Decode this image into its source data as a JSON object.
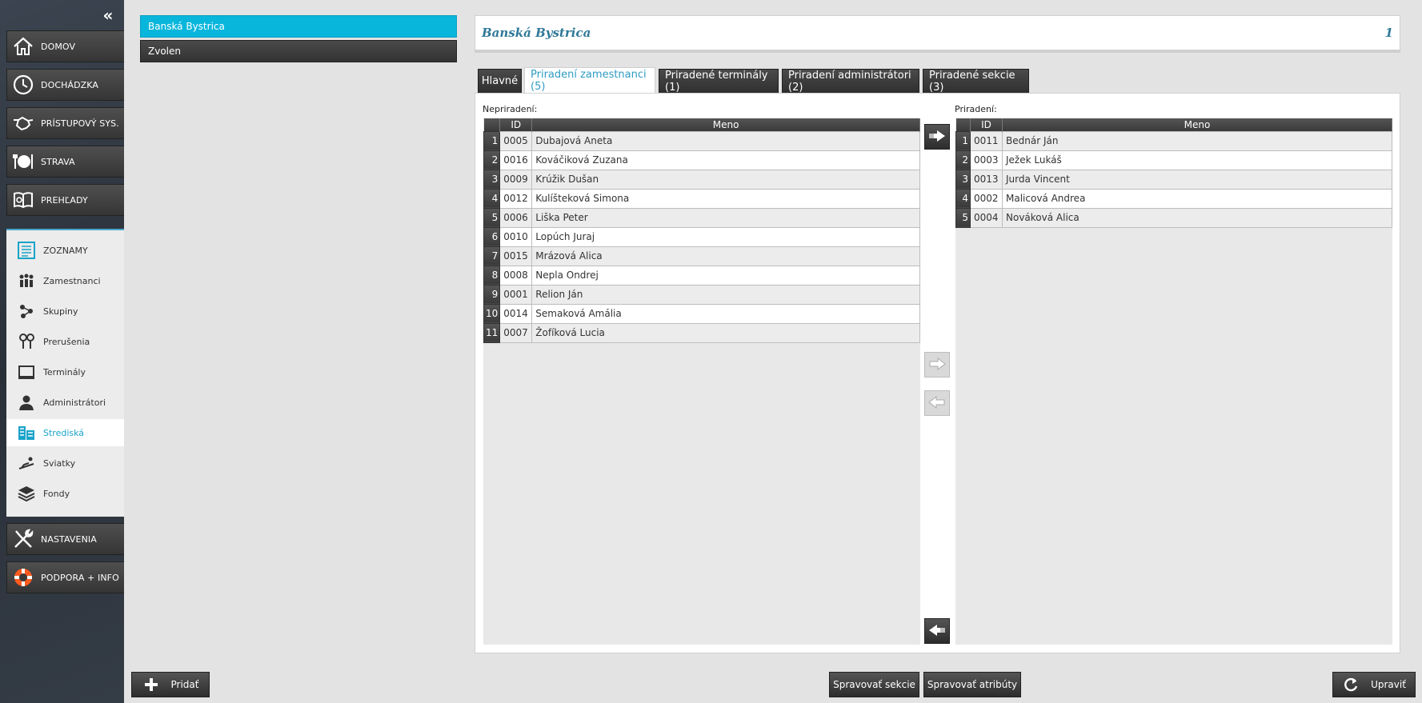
{
  "sidebar": {
    "collapse_icon": "chevron-double-left-icon",
    "main_items": [
      {
        "label": "DOMOV",
        "icon": "home-icon"
      },
      {
        "label": "DOCHÁDZKA",
        "icon": "clock-icon"
      },
      {
        "label": "PRÍSTUPOVÝ SYS.",
        "icon": "handshake-icon"
      },
      {
        "label": "STRAVA",
        "icon": "plate-icon"
      },
      {
        "label": "PREHĽADY",
        "icon": "report-icon"
      }
    ],
    "submenu": {
      "header": {
        "label": "ZOZNAMY",
        "icon": "list-icon"
      },
      "items": [
        {
          "label": "Zamestnanci",
          "icon": "people-icon"
        },
        {
          "label": "Skupiny",
          "icon": "groups-icon"
        },
        {
          "label": "Prerušenia",
          "icon": "pins-icon"
        },
        {
          "label": "Terminály",
          "icon": "terminal-icon"
        },
        {
          "label": "Administrátori",
          "icon": "admin-icon"
        },
        {
          "label": "Strediská",
          "icon": "building-icon",
          "active": true
        },
        {
          "label": "Sviatky",
          "icon": "sunbed-icon"
        },
        {
          "label": "Fondy",
          "icon": "layers-icon"
        }
      ]
    },
    "bottom_items": [
      {
        "label": "NASTAVENIA",
        "icon": "tools-icon"
      },
      {
        "label": "PODPORA + INFO",
        "icon": "lifebuoy-icon"
      }
    ]
  },
  "locations": [
    {
      "label": "Banská Bystrica",
      "selected": true
    },
    {
      "label": "Zvolen",
      "selected": false
    }
  ],
  "detail": {
    "title": "Banská Bystrica",
    "number": "1",
    "tabs": [
      {
        "label": "Hlavné"
      },
      {
        "label": "Priradení zamestnanci (5)",
        "active": true
      },
      {
        "label": "Priradené terminály (1)"
      },
      {
        "label": "Priradení administrátori (2)"
      },
      {
        "label": "Priradené sekcie (3)"
      }
    ],
    "unassigned": {
      "label": "Nepriradení:",
      "columns": [
        "ID",
        "Meno"
      ],
      "rows": [
        {
          "n": "1",
          "id": "0005",
          "name": "Dubajová Aneta"
        },
        {
          "n": "2",
          "id": "0016",
          "name": "Kováčiková Zuzana"
        },
        {
          "n": "3",
          "id": "0009",
          "name": "Krúžik Dušan"
        },
        {
          "n": "4",
          "id": "0012",
          "name": "Kulíšteková Simona"
        },
        {
          "n": "5",
          "id": "0006",
          "name": "Liška Peter"
        },
        {
          "n": "6",
          "id": "0010",
          "name": "Lopúch Juraj"
        },
        {
          "n": "7",
          "id": "0015",
          "name": "Mrázová Alica"
        },
        {
          "n": "8",
          "id": "0008",
          "name": "Nepla Ondrej"
        },
        {
          "n": "9",
          "id": "0001",
          "name": "Relion Ján"
        },
        {
          "n": "10",
          "id": "0014",
          "name": "Semaková Amália"
        },
        {
          "n": "11",
          "id": "0007",
          "name": "Žofíková Lucia"
        }
      ]
    },
    "assigned": {
      "label": "Priradení:",
      "columns": [
        "ID",
        "Meno"
      ],
      "rows": [
        {
          "n": "1",
          "id": "0011",
          "name": "Bednár Ján"
        },
        {
          "n": "2",
          "id": "0003",
          "name": "Ježek Lukáš"
        },
        {
          "n": "3",
          "id": "0013",
          "name": "Jurda Vincent"
        },
        {
          "n": "4",
          "id": "0002",
          "name": "Malicová Andrea"
        },
        {
          "n": "5",
          "id": "0004",
          "name": "Nováková Alica"
        }
      ]
    }
  },
  "bottom": {
    "add": "Pridať",
    "manage_sections": "Spravovať sekcie",
    "manage_attributes": "Spravovať atribúty",
    "edit": "Upraviť"
  }
}
